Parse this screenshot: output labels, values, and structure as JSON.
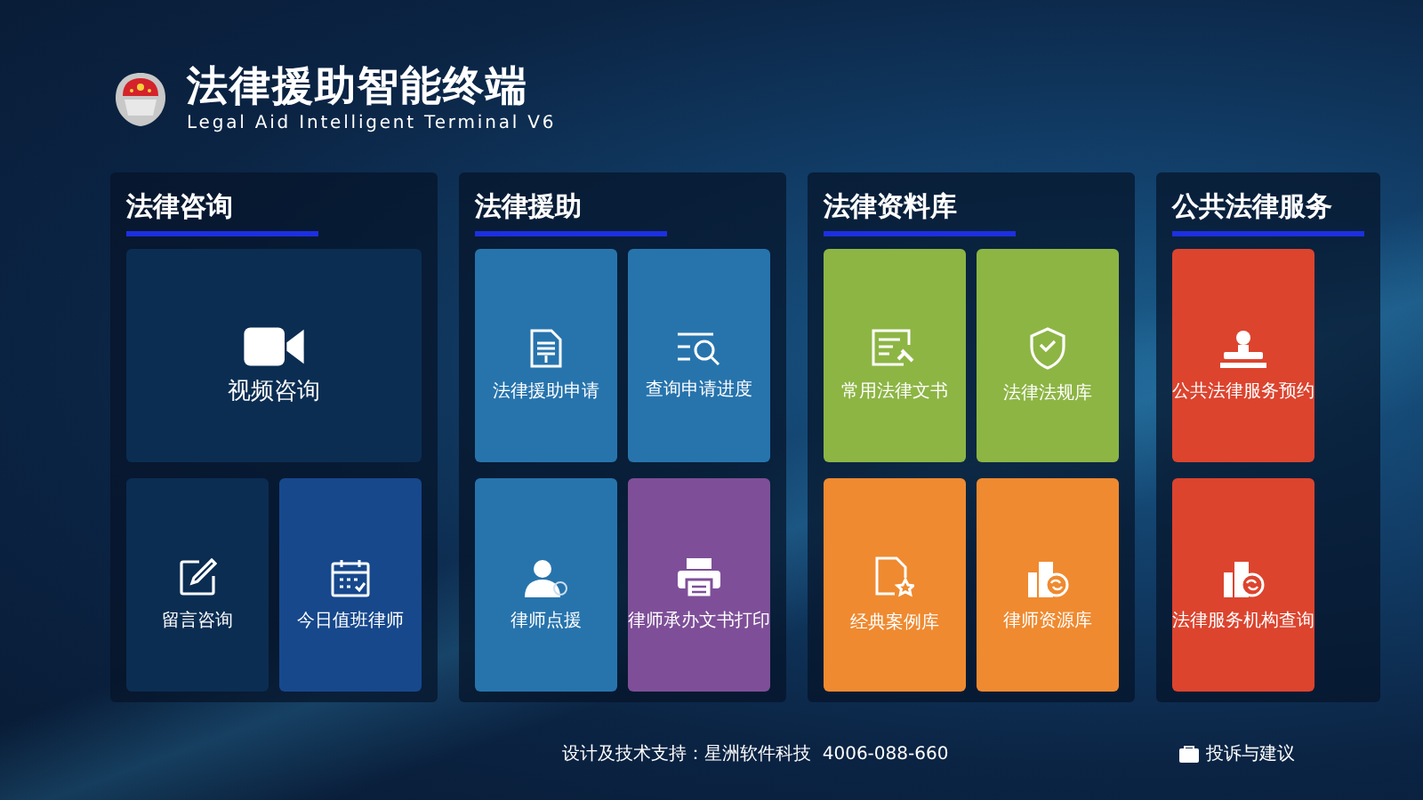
{
  "header": {
    "title": "法律援助智能终端",
    "subtitle": "Legal Aid Intelligent Terminal V6"
  },
  "panels": [
    {
      "title": "法律咨询",
      "tiles": [
        {
          "label": "视频咨询",
          "kind": "video",
          "color": "#0b2d52",
          "wide": true
        },
        {
          "label": "留言咨询",
          "kind": "edit",
          "color": "#0b2d52",
          "wide": false
        },
        {
          "label": "今日值班律师",
          "kind": "calendar",
          "color": "#17488c",
          "wide": false
        }
      ]
    },
    {
      "title": "法律援助",
      "tiles": [
        {
          "label": "法律援助申请",
          "kind": "document",
          "color": "#2774ad",
          "wide": false
        },
        {
          "label": "查询申请进度",
          "kind": "search-list",
          "color": "#2774ad",
          "wide": false
        },
        {
          "label": "律师点援",
          "kind": "person",
          "color": "#2774ad",
          "wide": false
        },
        {
          "label": "律师承办文书打印",
          "kind": "printer",
          "color": "#7e4f98",
          "wide": false
        }
      ]
    },
    {
      "title": "法律资料库",
      "tiles": [
        {
          "label": "常用法律文书",
          "kind": "certificate",
          "color": "#8db544",
          "wide": false
        },
        {
          "label": "法律法规库",
          "kind": "shield",
          "color": "#8db544",
          "wide": false
        },
        {
          "label": "经典案例库",
          "kind": "doc-star",
          "color": "#ef8a30",
          "wide": false
        },
        {
          "label": "律师资源库",
          "kind": "buildings",
          "color": "#ef8a30",
          "wide": false
        }
      ]
    },
    {
      "title": "公共法律服务",
      "tiles": [
        {
          "label": "公共法律服务预约",
          "kind": "stamp",
          "color": "#dc442e",
          "wide": false
        },
        {
          "label": "法律服务机构查询",
          "kind": "buildings",
          "color": "#dc442e",
          "wide": false
        }
      ]
    }
  ],
  "footer": {
    "support": "设计及技术支持：星洲软件科技  4006-088-660",
    "feedback": "投诉与建议"
  }
}
